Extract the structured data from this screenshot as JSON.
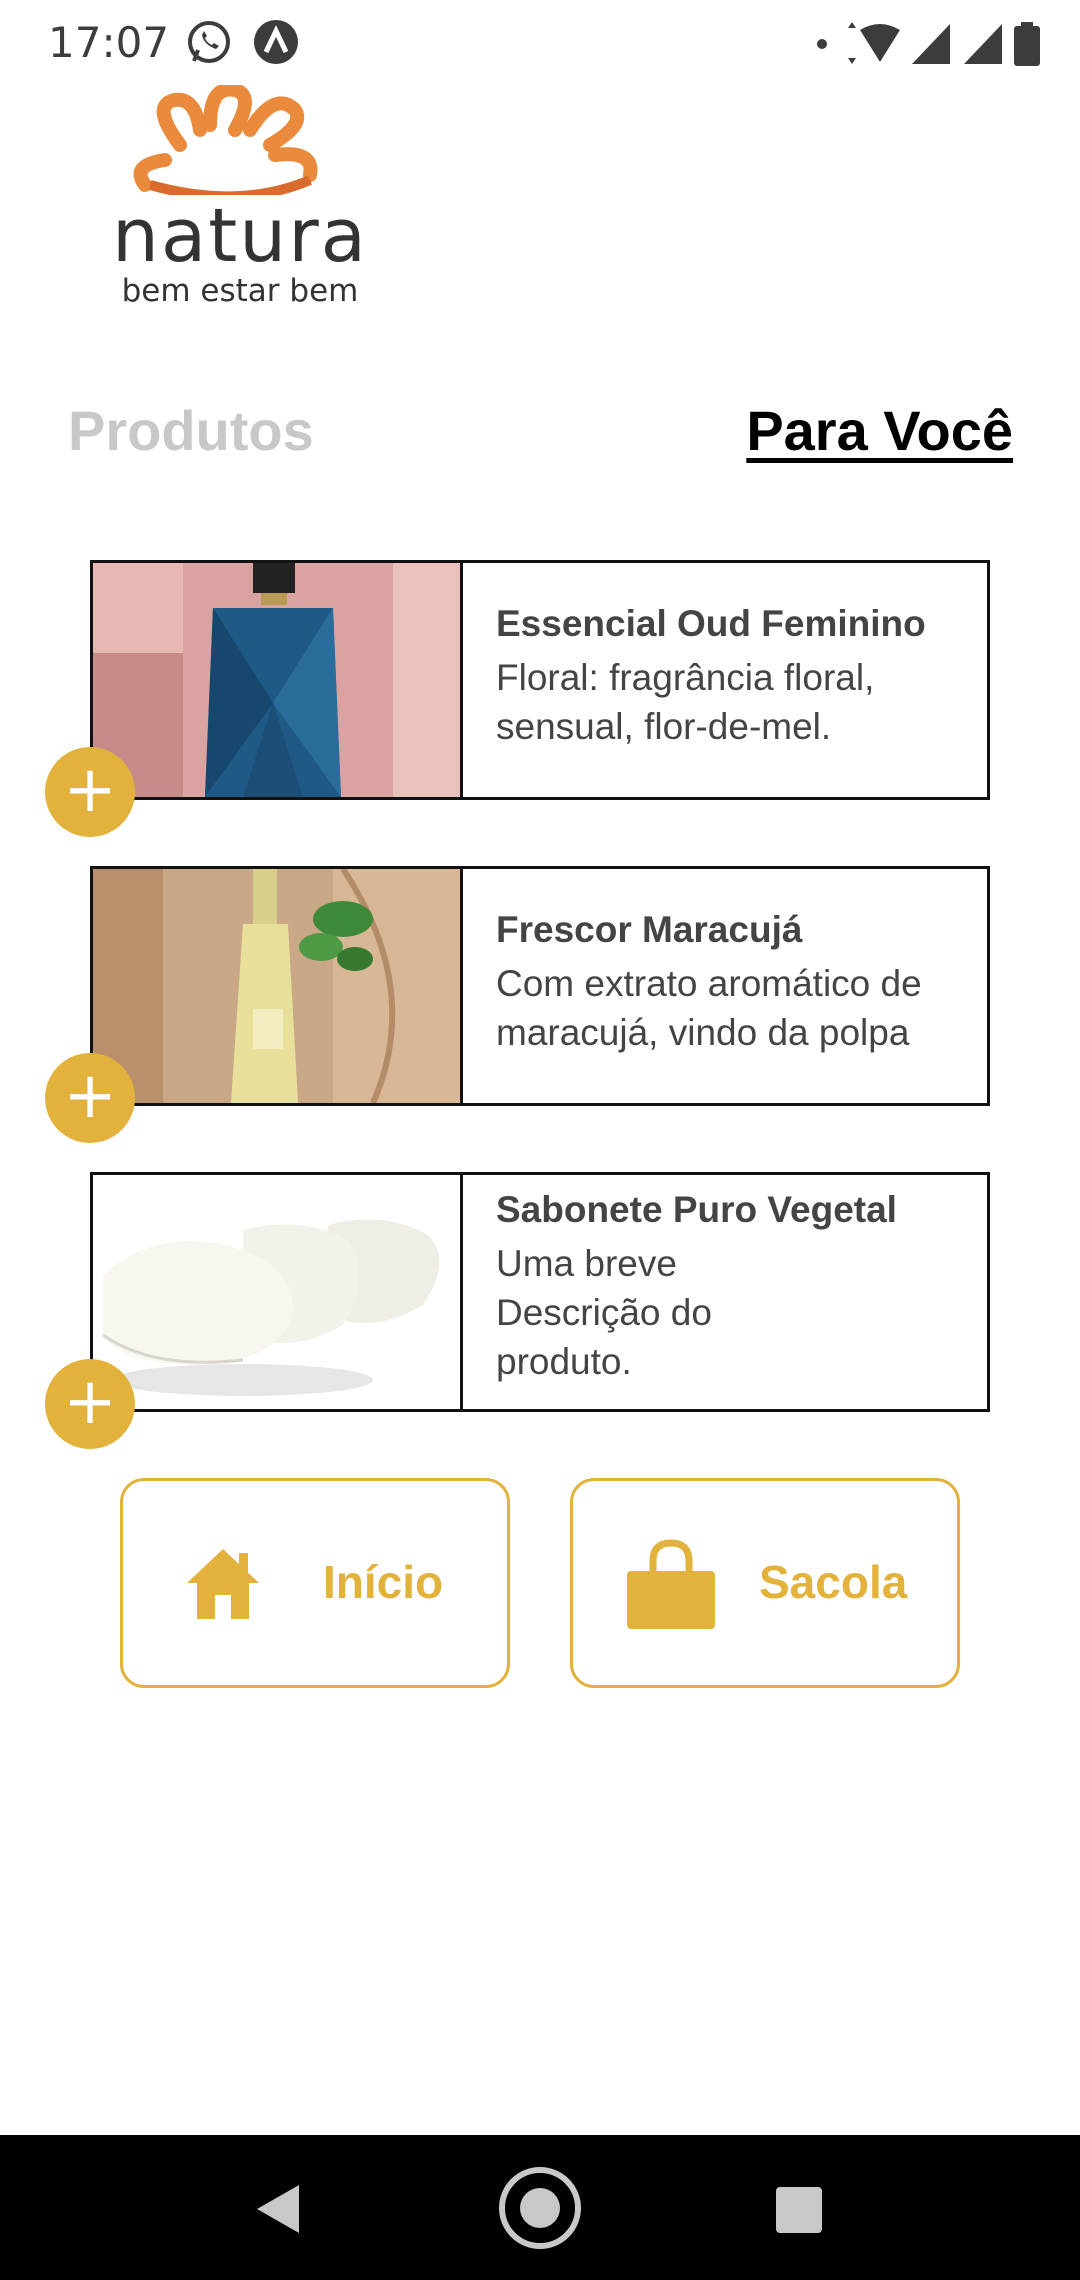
{
  "status_bar": {
    "time": "17:07",
    "icons": [
      "whatsapp-icon",
      "app-icon",
      "dot-icon",
      "wifi-icon",
      "signal-icon",
      "signal-icon",
      "battery-icon"
    ]
  },
  "logo": {
    "wordmark": "natura",
    "tagline": "bem estar bem",
    "brand_color": "#e98a3c"
  },
  "tabs": [
    {
      "label": "Produtos",
      "active": false
    },
    {
      "label": "Para Você",
      "active": true
    }
  ],
  "products": [
    {
      "title": "Essencial Oud Feminino",
      "description": "Floral: fragrância floral, sensual, flor-de-mel."
    },
    {
      "title": "Frescor Maracujá",
      "description": "Com extrato aromático de maracujá, vindo da polpa"
    },
    {
      "title": "Sabonete Puro Vegetal",
      "description": "Uma breve Descrição do produto."
    }
  ],
  "add_label": "+",
  "buttons": {
    "inicio": "Início",
    "sacola": "Sacola"
  },
  "colors": {
    "accent": "#e2b23d",
    "inactive_tab": "#c8c8c8"
  }
}
